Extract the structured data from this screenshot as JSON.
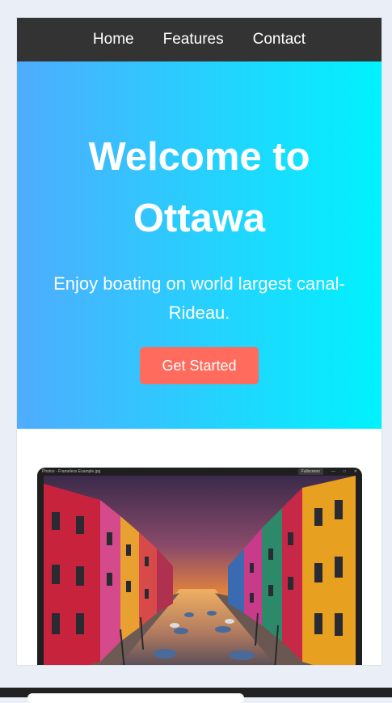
{
  "nav": {
    "items": [
      {
        "label": "Home"
      },
      {
        "label": "Features"
      },
      {
        "label": "Contact"
      }
    ]
  },
  "hero": {
    "title": "Welcome to Ottawa",
    "subtitle": "Enjoy boating on world largest canal- Rideau.",
    "cta_label": "Get Started",
    "gradient_start": "#4facfe",
    "gradient_end": "#00f2fe",
    "cta_color": "#ff6b5c"
  },
  "photo_window": {
    "title": "Photos - Frameless Example.jpg",
    "fullscreen_label": "Fullscreen",
    "minimize_glyph": "—",
    "maximize_glyph": "□",
    "close_glyph": "✕"
  },
  "colors": {
    "navbar": "#333333",
    "page_background": "#eaeef6"
  }
}
